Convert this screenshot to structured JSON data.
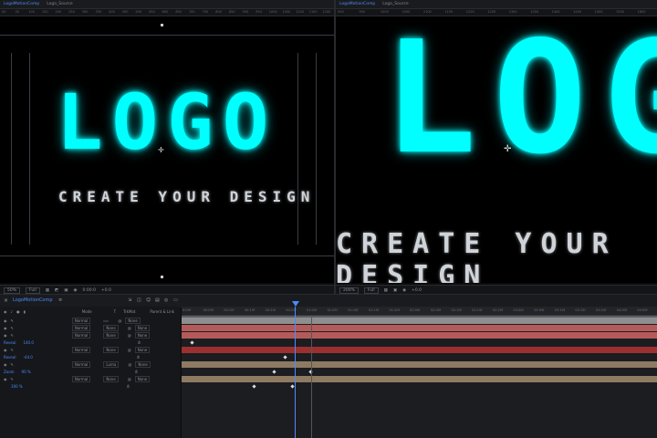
{
  "left_panel": {
    "tabs": [
      "LogoMotionComp",
      "Logo_Source"
    ],
    "active_tab": 0,
    "ruler": [
      "00",
      "50",
      "100",
      "150",
      "200",
      "250",
      "300",
      "350",
      "400",
      "450",
      "500",
      "550",
      "600",
      "650",
      "700",
      "750",
      "800",
      "850",
      "900",
      "950",
      "1000",
      "1050",
      "1100",
      "1150",
      "1200"
    ],
    "logo_text": "LOGO",
    "tagline": "CREATE YOUR DESIGN",
    "toolbar": {
      "zoom": "50%",
      "resolution": "Full",
      "time": "0:00:0",
      "exposure": "+0.0"
    }
  },
  "right_panel": {
    "tabs": [
      "LogoMotionComp",
      "Logo_Source"
    ],
    "active_tab": 0,
    "ruler": [
      "900",
      "950",
      "1000",
      "1050",
      "1100",
      "1150",
      "1200",
      "1250",
      "1300",
      "1350",
      "1400",
      "1450",
      "1500",
      "1550",
      "1600"
    ],
    "logo_text": "LOGO",
    "tagline": "CREATE YOUR DESIGN",
    "toolbar": {
      "zoom": "200%",
      "resolution": "Full",
      "exposure": "+0.0"
    }
  },
  "timeline": {
    "tab": "LogoMotionComp",
    "column_headers": [
      "Mode",
      "T",
      "TrkMat",
      "Parent & Link"
    ],
    "time_marks": [
      "0:00f",
      "00:05f",
      "00:10f",
      "00:15f",
      "00:20f",
      "00:25f",
      "01:00f",
      "01:05f",
      "01:10f",
      "01:15f",
      "01:20f",
      "02:00f",
      "02:05f",
      "02:10f",
      "02:15f",
      "02:20f",
      "03:00f",
      "03:05f",
      "03:10f",
      "03:15f",
      "03:20f",
      "04:00f",
      "04:05f"
    ],
    "layers": [
      {
        "mode": "Normal",
        "trkmat": "",
        "parent": "None",
        "color": "#8e8e8e"
      },
      {
        "mode": "Normal",
        "trkmat": "None",
        "parent": "None",
        "color": "#b55a5a"
      },
      {
        "mode": "Normal",
        "trkmat": "None",
        "parent": "None",
        "color": "#b55a5a"
      },
      {
        "label": "Reveal",
        "value": "140.0",
        "color": ""
      },
      {
        "mode": "Normal",
        "trkmat": "None",
        "parent": "None",
        "color": "#9c3030"
      },
      {
        "label": "Reveal",
        "value": "-44.0",
        "color": ""
      },
      {
        "mode": "Normal",
        "trkmat": "Luma",
        "parent": "None",
        "color": "#8e7a63"
      },
      {
        "label": "Zoom",
        "value": "90 %",
        "color": ""
      },
      {
        "mode": "Normal",
        "trkmat": "None",
        "parent": "None",
        "color": "#8e7a63"
      },
      {
        "label": "",
        "value": "100 %",
        "color": ""
      }
    ],
    "accent": "#4a8cff"
  }
}
